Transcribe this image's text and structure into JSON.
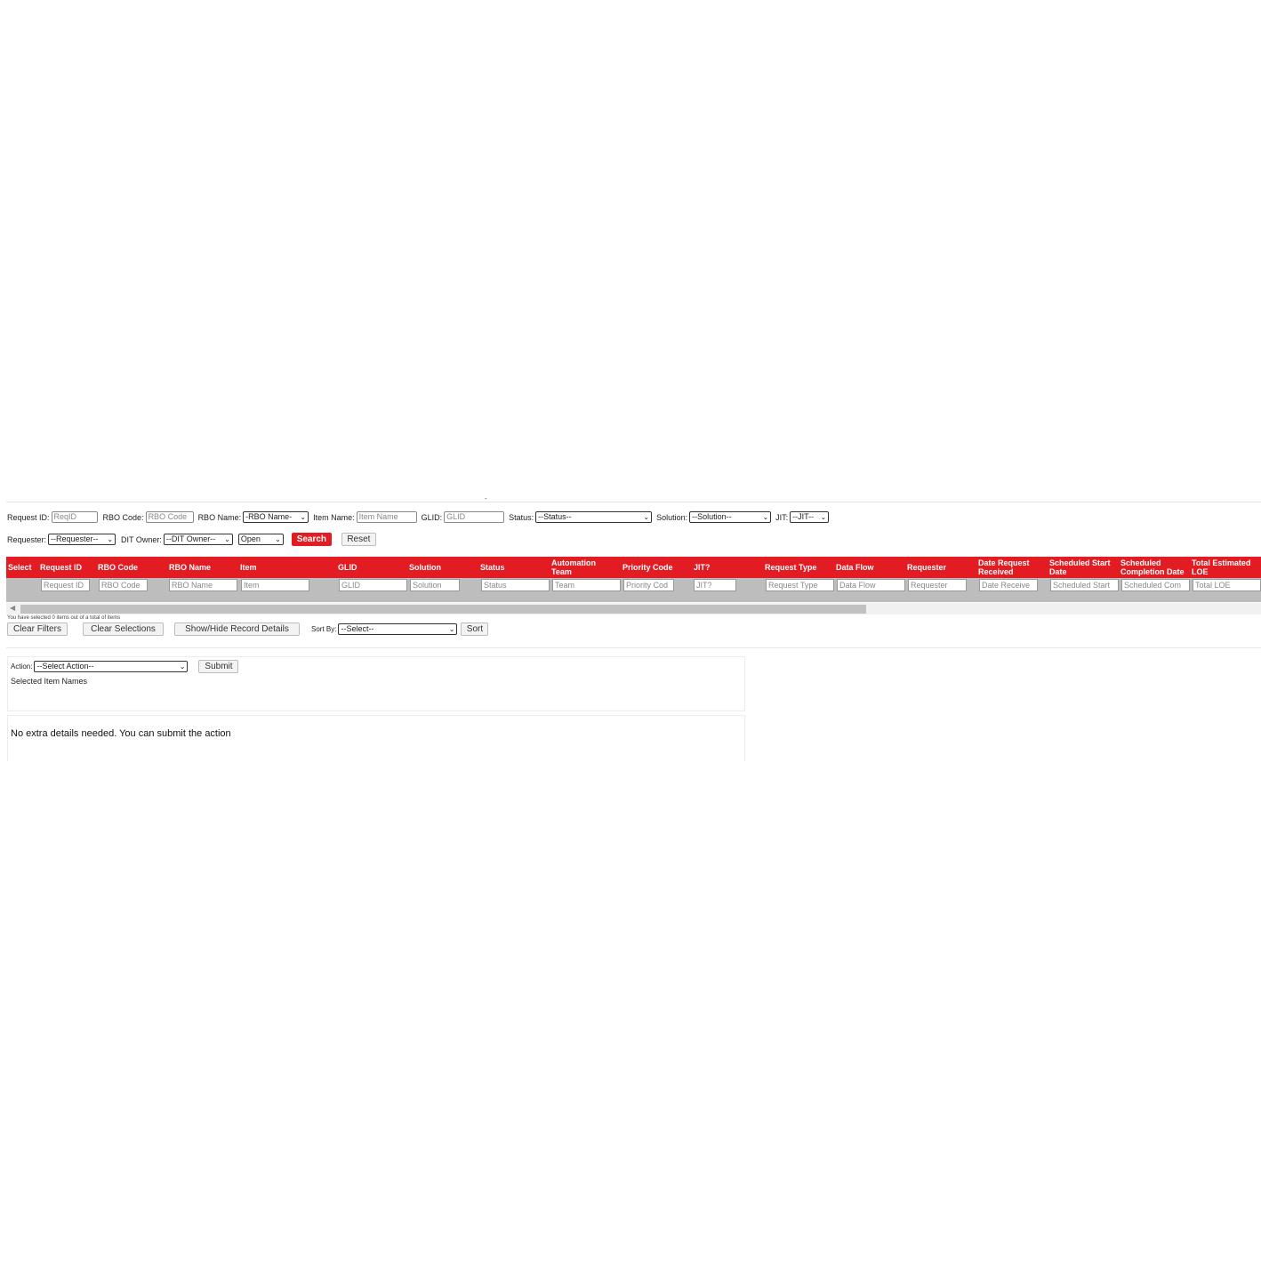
{
  "filters": {
    "request_id_label": "Request ID:",
    "request_id_placeholder": "ReqID",
    "rbo_code_label": "RBO Code:",
    "rbo_code_placeholder": "RBO Code",
    "rbo_name_label": "RBO Name:",
    "rbo_name_selected": "-RBO Name-",
    "item_name_label": "Item Name:",
    "item_name_placeholder": "Item Name",
    "glid_label": "GLID:",
    "glid_placeholder": "GLID",
    "status_label": "Status:",
    "status_selected": "--Status--",
    "solution_label": "Solution:",
    "solution_selected": "--Solution--",
    "jit_label": "JIT:",
    "jit_selected": "--JIT--",
    "requester_label": "Requester:",
    "requester_selected": "--Requester--",
    "dit_owner_label": "DIT Owner:",
    "dit_owner_selected": "--DIT Owner--",
    "open_selected": "Open",
    "search_label": "Search",
    "reset_label": "Reset"
  },
  "table": {
    "columns": [
      {
        "label": "Select",
        "filter": ""
      },
      {
        "label": "Request ID",
        "filter": "Request ID"
      },
      {
        "label": "RBO Code",
        "filter": "RBO Code"
      },
      {
        "label": "RBO Name",
        "filter": "RBO Name"
      },
      {
        "label": "Item",
        "filter": "Item"
      },
      {
        "label": "GLID",
        "filter": "GLID"
      },
      {
        "label": "Solution",
        "filter": "Solution"
      },
      {
        "label": "Status",
        "filter": "Status"
      },
      {
        "label": "Automation Team",
        "filter": "Team"
      },
      {
        "label": "Priority Code",
        "filter": "Priority Cod"
      },
      {
        "label": "JIT?",
        "filter": "JIT?"
      },
      {
        "label": "Request Type",
        "filter": "Request Type"
      },
      {
        "label": "Data Flow",
        "filter": "Data Flow"
      },
      {
        "label": "Requester",
        "filter": "Requester"
      },
      {
        "label": "Date Request Received",
        "filter": "Date Receive"
      },
      {
        "label": "Scheduled Start Date",
        "filter": "Scheduled Start"
      },
      {
        "label": "Scheduled Completion Date",
        "filter": "Scheduled Com"
      },
      {
        "label": "Total Estimated LOE",
        "filter": "Total LOE"
      }
    ],
    "selection_info": "You have selected 0 items out of a total of items"
  },
  "toolbar": {
    "clear_filters": "Clear Filters",
    "clear_selections": "Clear Selections",
    "show_hide": "Show/Hide Record Details",
    "sort_by_label": "Sort By:",
    "sort_by_selected": "--Select--",
    "sort_label": "Sort"
  },
  "action": {
    "label": "Action:",
    "selected": "--Select Action--",
    "submit_label": "Submit",
    "selected_items_label": "Selected Item Names",
    "message": "No extra details needed. You can submit the action"
  },
  "colors": {
    "accent": "#e31c24",
    "filter_row": "#bdbdbd"
  },
  "icons": [
    "chevron-down-icon",
    "scroll-left-arrow-icon"
  ]
}
